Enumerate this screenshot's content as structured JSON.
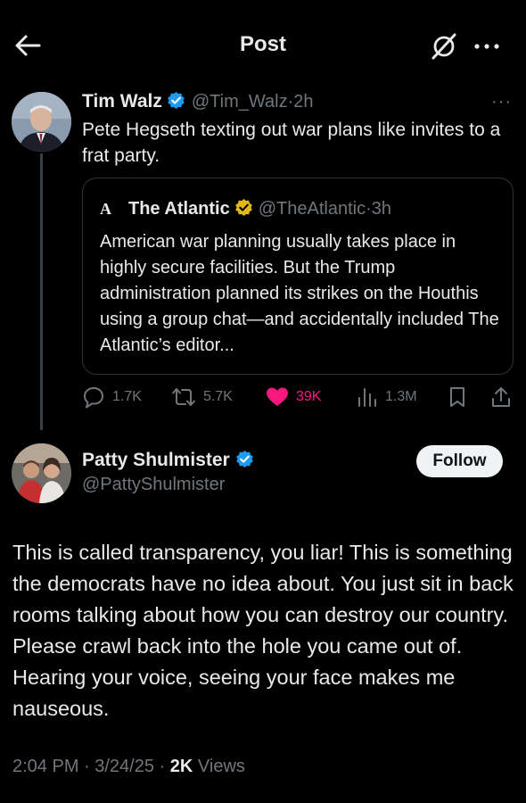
{
  "header": {
    "title": "Post",
    "back_icon": "arrow-left-icon",
    "grok_icon": "grok-icon",
    "more_icon": "more-horizontal-icon"
  },
  "original_tweet": {
    "author_name": "Tim Walz",
    "handle": "@Tim_Walz",
    "separator": "·",
    "time": "2h",
    "more": "···",
    "text": "Pete Hegseth texting out war plans like invites to a frat party.",
    "quote": {
      "logo": "A",
      "author_name": "The Atlantic",
      "handle": "@TheAtlantic",
      "separator": "·",
      "time": "3h",
      "text": "American war planning usually takes place in highly secure facilities. But the Trump administration planned its strikes on the Houthis using a group chat—and accidentally included The Atlantic’s editor..."
    },
    "actions": {
      "replies": "1.7K",
      "retweets": "5.7K",
      "likes": "39K",
      "views": "1.3M"
    }
  },
  "reply": {
    "author_name": "Patty Shulmister",
    "handle": "@PattyShulmister",
    "follow_label": "Follow",
    "text": "This is called transparency, you liar! This is something the democrats have no idea about. You just sit in back rooms talking about how you can destroy our country. Please crawl back into the hole you came out of. Hearing your voice, seeing your face makes me nauseous.",
    "timestamp": "2:04 PM · 3/24/25 · ",
    "views_count": "2K",
    "views_label": " Views"
  },
  "colors": {
    "background": "#000000",
    "text": "#e7e9ea",
    "muted": "#71767b",
    "verified_blue": "#1d9bf0",
    "verified_gold": "#e2b719",
    "like_pink": "#f91880",
    "border": "#2f3336"
  }
}
